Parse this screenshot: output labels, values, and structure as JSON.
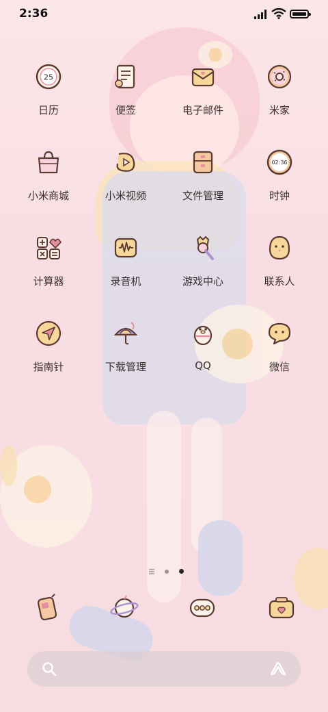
{
  "status_bar": {
    "time": "2:36"
  },
  "apps": [
    {
      "label": "日历",
      "icon": "calendar-icon",
      "badge": "25"
    },
    {
      "label": "便签",
      "icon": "notes-icon"
    },
    {
      "label": "电子邮件",
      "icon": "email-icon"
    },
    {
      "label": "米家",
      "icon": "mijia-donut-icon"
    },
    {
      "label": "小米商城",
      "icon": "shopping-bag-icon"
    },
    {
      "label": "小米视频",
      "icon": "video-icon"
    },
    {
      "label": "文件管理",
      "icon": "file-manager-icon"
    },
    {
      "label": "时钟",
      "icon": "clock-icon",
      "badge": "02:36"
    },
    {
      "label": "计算器",
      "icon": "calculator-icon"
    },
    {
      "label": "录音机",
      "icon": "recorder-icon"
    },
    {
      "label": "游戏中心",
      "icon": "game-center-icon"
    },
    {
      "label": "联系人",
      "icon": "contacts-chick-icon"
    },
    {
      "label": "指南针",
      "icon": "compass-icon"
    },
    {
      "label": "下载管理",
      "icon": "download-manager-icon"
    },
    {
      "label": "QQ",
      "icon": "qq-penguin-icon"
    },
    {
      "label": "微信",
      "icon": "wechat-icon"
    }
  ],
  "page_indicator": {
    "pages": 3,
    "current": 3
  },
  "dock": [
    {
      "icon": "phone-icon"
    },
    {
      "icon": "browser-planet-icon"
    },
    {
      "icon": "messages-icon"
    },
    {
      "icon": "camera-icon"
    }
  ],
  "colors": {
    "icon_outline": "#5a3a30",
    "icon_fill": "#f4c9a0",
    "accent_pink": "#e98ea0"
  }
}
